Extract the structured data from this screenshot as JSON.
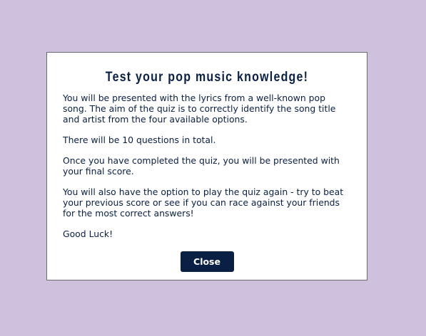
{
  "modal": {
    "title": "Test your pop music knowledge!",
    "paragraphs": [
      "You will be presented with the lyrics from a well-known pop song. The aim of the quiz is to correctly identify the song title and artist from the four available options.",
      "There will be 10 questions in total.",
      "Once you have completed the quiz, you will be presented with your final score.",
      "You will also have the option to play the quiz again - try to beat your previous score or see if you can race against your friends for the most correct answers!",
      "Good Luck!"
    ],
    "close_label": "Close"
  },
  "colors": {
    "background": "#cdc1dd",
    "modal_background": "#ffffff",
    "text": "#0a1f44",
    "button_background": "#0a1f44",
    "button_text": "#ffffff"
  }
}
